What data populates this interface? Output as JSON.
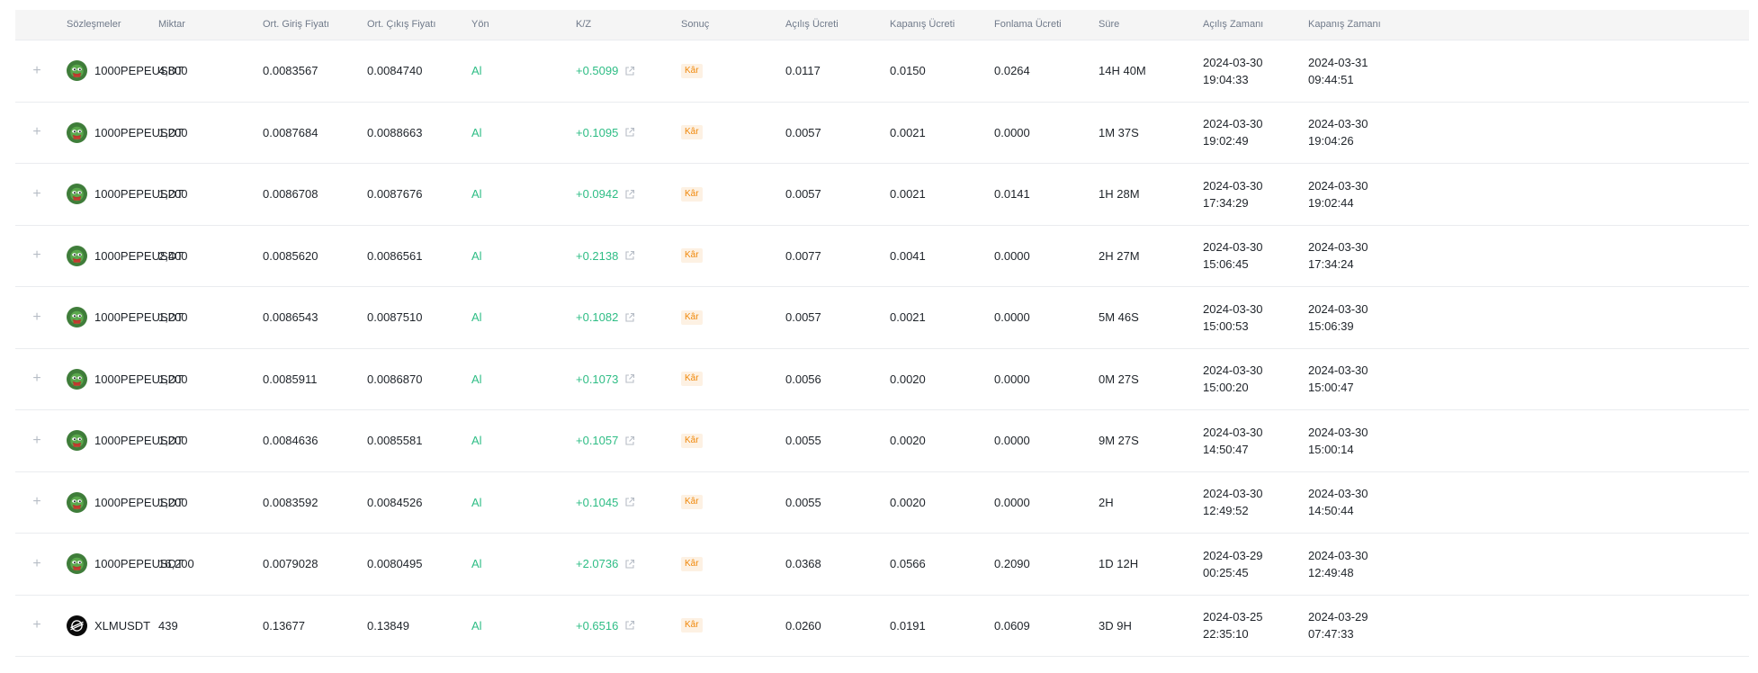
{
  "columns": [
    "Sözleşmeler",
    "Miktar",
    "Ort. Giriş Fiyatı",
    "Ort. Çıkış Fiyatı",
    "Yön",
    "K/Z",
    "Sonuç",
    "Açılış Ücreti",
    "Kapanış Ücreti",
    "Fonlama Ücreti",
    "Süre",
    "Açılış Zamanı",
    "Kapanış Zamanı"
  ],
  "expand_symbol": "+",
  "rows": [
    {
      "icon": "pepe-coin-icon",
      "symbol": "1000PEPEUSDT",
      "qty": "4,800",
      "entry": "0.0083567",
      "exit": "0.0084740",
      "side": "Al",
      "pnl": "+0.5099",
      "result": "Kâr",
      "open_fee": "0.0117",
      "close_fee": "0.0150",
      "funding_fee": "0.0264",
      "duration": "14H 40M",
      "open_date": "2024-03-30",
      "open_clock": "19:04:33",
      "close_date": "2024-03-31",
      "close_clock": "09:44:51"
    },
    {
      "icon": "pepe-coin-icon",
      "symbol": "1000PEPEUSDT",
      "qty": "1,200",
      "entry": "0.0087684",
      "exit": "0.0088663",
      "side": "Al",
      "pnl": "+0.1095",
      "result": "Kâr",
      "open_fee": "0.0057",
      "close_fee": "0.0021",
      "funding_fee": "0.0000",
      "duration": "1M 37S",
      "open_date": "2024-03-30",
      "open_clock": "19:02:49",
      "close_date": "2024-03-30",
      "close_clock": "19:04:26"
    },
    {
      "icon": "pepe-coin-icon",
      "symbol": "1000PEPEUSDT",
      "qty": "1,200",
      "entry": "0.0086708",
      "exit": "0.0087676",
      "side": "Al",
      "pnl": "+0.0942",
      "result": "Kâr",
      "open_fee": "0.0057",
      "close_fee": "0.0021",
      "funding_fee": "0.0141",
      "duration": "1H 28M",
      "open_date": "2024-03-30",
      "open_clock": "17:34:29",
      "close_date": "2024-03-30",
      "close_clock": "19:02:44"
    },
    {
      "icon": "pepe-coin-icon",
      "symbol": "1000PEPEUSDT",
      "qty": "2,400",
      "entry": "0.0085620",
      "exit": "0.0086561",
      "side": "Al",
      "pnl": "+0.2138",
      "result": "Kâr",
      "open_fee": "0.0077",
      "close_fee": "0.0041",
      "funding_fee": "0.0000",
      "duration": "2H 27M",
      "open_date": "2024-03-30",
      "open_clock": "15:06:45",
      "close_date": "2024-03-30",
      "close_clock": "17:34:24"
    },
    {
      "icon": "pepe-coin-icon",
      "symbol": "1000PEPEUSDT",
      "qty": "1,200",
      "entry": "0.0086543",
      "exit": "0.0087510",
      "side": "Al",
      "pnl": "+0.1082",
      "result": "Kâr",
      "open_fee": "0.0057",
      "close_fee": "0.0021",
      "funding_fee": "0.0000",
      "duration": "5M 46S",
      "open_date": "2024-03-30",
      "open_clock": "15:00:53",
      "close_date": "2024-03-30",
      "close_clock": "15:06:39"
    },
    {
      "icon": "pepe-coin-icon",
      "symbol": "1000PEPEUSDT",
      "qty": "1,200",
      "entry": "0.0085911",
      "exit": "0.0086870",
      "side": "Al",
      "pnl": "+0.1073",
      "result": "Kâr",
      "open_fee": "0.0056",
      "close_fee": "0.0020",
      "funding_fee": "0.0000",
      "duration": "0M 27S",
      "open_date": "2024-03-30",
      "open_clock": "15:00:20",
      "close_date": "2024-03-30",
      "close_clock": "15:00:47"
    },
    {
      "icon": "pepe-coin-icon",
      "symbol": "1000PEPEUSDT",
      "qty": "1,200",
      "entry": "0.0084636",
      "exit": "0.0085581",
      "side": "Al",
      "pnl": "+0.1057",
      "result": "Kâr",
      "open_fee": "0.0055",
      "close_fee": "0.0020",
      "funding_fee": "0.0000",
      "duration": "9M 27S",
      "open_date": "2024-03-30",
      "open_clock": "14:50:47",
      "close_date": "2024-03-30",
      "close_clock": "15:00:14"
    },
    {
      "icon": "pepe-coin-icon",
      "symbol": "1000PEPEUSDT",
      "qty": "1,200",
      "entry": "0.0083592",
      "exit": "0.0084526",
      "side": "Al",
      "pnl": "+0.1045",
      "result": "Kâr",
      "open_fee": "0.0055",
      "close_fee": "0.0020",
      "funding_fee": "0.0000",
      "duration": "2H",
      "open_date": "2024-03-30",
      "open_clock": "12:49:52",
      "close_date": "2024-03-30",
      "close_clock": "14:50:44"
    },
    {
      "icon": "pepe-coin-icon",
      "symbol": "1000PEPEUSDT",
      "qty": "16,200",
      "entry": "0.0079028",
      "exit": "0.0080495",
      "side": "Al",
      "pnl": "+2.0736",
      "result": "Kâr",
      "open_fee": "0.0368",
      "close_fee": "0.0566",
      "funding_fee": "0.2090",
      "duration": "1D 12H",
      "open_date": "2024-03-29",
      "open_clock": "00:25:45",
      "close_date": "2024-03-30",
      "close_clock": "12:49:48"
    },
    {
      "icon": "stellar-coin-icon",
      "symbol": "XLMUSDT",
      "qty": "439",
      "entry": "0.13677",
      "exit": "0.13849",
      "side": "Al",
      "pnl": "+0.6516",
      "result": "Kâr",
      "open_fee": "0.0260",
      "close_fee": "0.0191",
      "funding_fee": "0.0609",
      "duration": "3D 9H",
      "open_date": "2024-03-25",
      "open_clock": "22:35:10",
      "close_date": "2024-03-29",
      "close_clock": "07:47:33"
    }
  ],
  "colors": {
    "profit_green": "#2ebd85",
    "result_badge_text": "#f0880a",
    "result_badge_bg": "#fdf1e3",
    "header_bg": "#f5f5f5",
    "header_text": "#707a8a"
  }
}
